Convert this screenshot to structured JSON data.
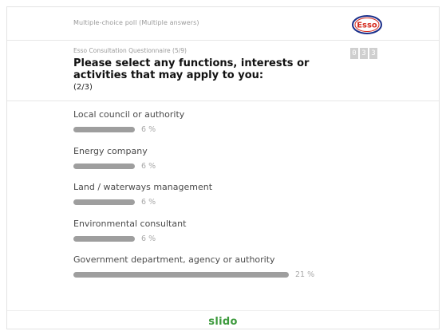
{
  "poll": {
    "type_label": "Multiple-choice poll (Multiple answers)",
    "logo_text": "Esso",
    "subtitle": "Esso Consultation Questionnaire (5/9)",
    "question": "Please select any functions, interests or activities that may apply to you:",
    "page_indicator": "(2/3)",
    "counter": [
      "0",
      "3",
      "3"
    ],
    "options": [
      {
        "label": "Local council or authority",
        "percent": 6,
        "percent_text": "6 %"
      },
      {
        "label": "Energy company",
        "percent": 6,
        "percent_text": "6 %"
      },
      {
        "label": "Land / waterways management",
        "percent": 6,
        "percent_text": "6 %"
      },
      {
        "label": "Environmental consultant",
        "percent": 6,
        "percent_text": "6 %"
      },
      {
        "label": "Government department, agency or authority",
        "percent": 21,
        "percent_text": "21 %"
      }
    ]
  },
  "footer": {
    "brand": "slido"
  },
  "colors": {
    "bar": "#9e9e9e",
    "brand_green": "#3d9a3d",
    "esso_red": "#d52b1e",
    "esso_blue": "#1b2f8a"
  }
}
